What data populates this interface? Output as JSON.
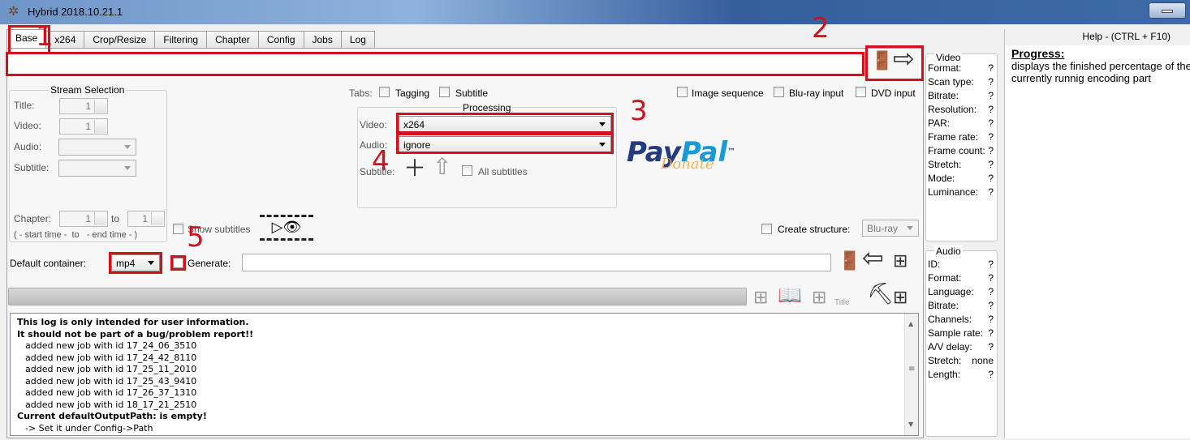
{
  "window": {
    "title": "Hybrid 2018.10.21.1"
  },
  "tabs": [
    "Base",
    "x264",
    "Crop/Resize",
    "Filtering",
    "Chapter",
    "Config",
    "Jobs",
    "Log"
  ],
  "annotations": [
    "1",
    "2",
    "3",
    "4",
    "5"
  ],
  "stream_selection": {
    "title": "Stream Selection",
    "title_label": "Title:",
    "title_value": "1",
    "video_label": "Video:",
    "video_value": "1",
    "audio_label": "Audio:",
    "subtitle_label": "Subtitle:",
    "chapter_label": "Chapter:",
    "chapter_from": "1",
    "chapter_to_label": "to",
    "chapter_to": "1",
    "chapter_hint": "( - start time -  to   - end time - )",
    "show_subtitles": "Show subtitles"
  },
  "tabs_row": {
    "label": "Tabs:",
    "tagging": "Tagging",
    "subtitle": "Subtitle"
  },
  "inputs": {
    "image_sequence": "Image sequence",
    "bluray_input": "Blu-ray input",
    "dvd_input": "DVD input"
  },
  "processing": {
    "title": "Processing",
    "video_label": "Video:",
    "video_value": "x264",
    "audio_label": "Audio:",
    "audio_value": "ignore",
    "subtitle_label": "Subtitle:",
    "all_subtitles": "All subtitles"
  },
  "paypal": {
    "text1": "Pay",
    "text2": "Pal",
    "sub": "Donate",
    "tm": "™"
  },
  "structure": {
    "label": "Create structure:",
    "value": "Blu-ray"
  },
  "container": {
    "label": "Default container:",
    "value": "mp4",
    "generate": "Generate:"
  },
  "bottom_icons": {
    "title_text": "Title"
  },
  "log": {
    "lines": [
      {
        "text": "This log is only intended for user information.",
        "style": "b"
      },
      {
        "text": "It should not be part of a bug/problem report!!",
        "style": "b"
      },
      {
        "text": "added new job with id 17_24_06_3510",
        "style": "i"
      },
      {
        "text": "added new job with id 17_24_42_8110",
        "style": "i"
      },
      {
        "text": "added new job with id 17_25_11_2010",
        "style": "i"
      },
      {
        "text": "added new job with id 17_25_43_9410",
        "style": "i"
      },
      {
        "text": "added new job with id 17_26_37_1310",
        "style": "i"
      },
      {
        "text": "added new job with id 18_17_21_2510",
        "style": "i"
      },
      {
        "text": "Current defaultOutputPath: is empty!",
        "style": "b"
      },
      {
        "text": "-> Set it under Config->Path",
        "style": "i"
      }
    ]
  },
  "video_info": {
    "title": "Video",
    "rows": [
      {
        "k": "Format:",
        "v": "?"
      },
      {
        "k": "Scan type:",
        "v": "?"
      },
      {
        "k": "Bitrate:",
        "v": "?"
      },
      {
        "k": "Resolution:",
        "v": "?"
      },
      {
        "k": "PAR:",
        "v": "?"
      },
      {
        "k": "Frame rate:",
        "v": "?"
      },
      {
        "k": "Frame count:",
        "v": "?"
      },
      {
        "k": "Stretch:",
        "v": "?"
      },
      {
        "k": "Mode:",
        "v": "?"
      },
      {
        "k": "Luminance:",
        "v": "?"
      }
    ]
  },
  "audio_info": {
    "title": "Audio",
    "rows": [
      {
        "k": "ID:",
        "v": "?"
      },
      {
        "k": "Format:",
        "v": "?"
      },
      {
        "k": "Language:",
        "v": "?"
      },
      {
        "k": "Bitrate:",
        "v": "?"
      },
      {
        "k": "Channels:",
        "v": "?"
      },
      {
        "k": "Sample rate:",
        "v": "?"
      },
      {
        "k": "A/V delay:",
        "v": "?"
      },
      {
        "k": "Stretch:",
        "v": "none"
      },
      {
        "k": "Length:",
        "v": "?"
      }
    ]
  },
  "help": {
    "header": "Help - (CTRL + F10)",
    "title": "Progress:",
    "line1": "displays the finished percentage of the",
    "line2": "currently runnig encoding part"
  },
  "colors": {
    "annotation": "#d4101c",
    "paypal_dark": "#253b80",
    "paypal_light": "#179bd7",
    "donate": "#f0a73a"
  }
}
